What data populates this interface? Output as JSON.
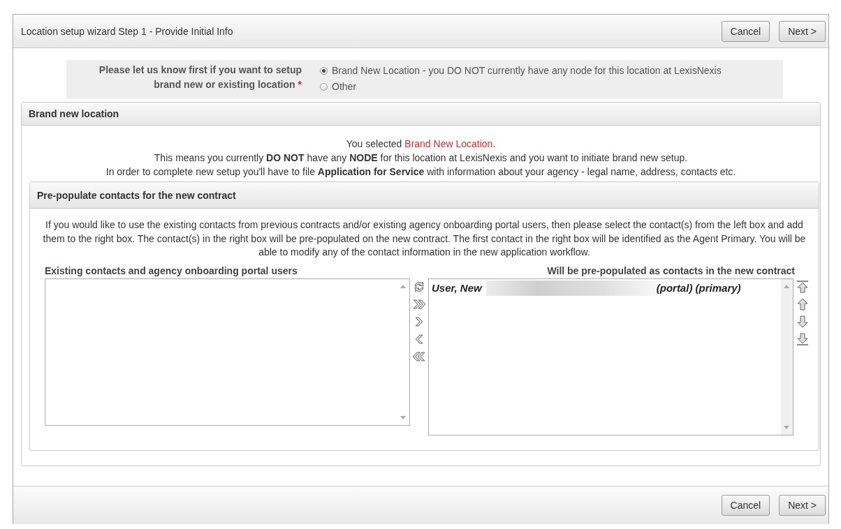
{
  "window": {
    "title": "Location setup wizard Step 1 - Provide Initial Info"
  },
  "header_buttons": [
    {
      "label": "Cancel"
    },
    {
      "label": "Next >"
    }
  ],
  "location_question": {
    "label": "Please let us know first if you want to setup brand new or existing location",
    "required_mark": "*",
    "options": [
      {
        "label": "Brand New Location - you DO NOT currently have any node for this location at LexisNexis",
        "selected": true
      },
      {
        "label": "Other",
        "selected": false
      }
    ]
  },
  "brand_new_panel": {
    "title": "Brand new location",
    "notice": {
      "prefix": "You selected ",
      "highlight": "Brand New Location",
      "suffix": "."
    },
    "lines": [
      "This means you currently **DO NOT** have any **NODE** for this location at LexisNexis and you want to initiate brand new setup.",
      "In order to complete new setup you'll have to file **Application for Service** with information about your agency - legal name, address, contacts etc."
    ]
  },
  "contacts_panel": {
    "title": "Pre-populate contacts for the new contract",
    "description": "If you would like to use the existing contacts from previous contracts and/or existing agency onboarding portal users, then please select the contact(s) from the left box and add them to the right box. The contact(s) in the right box will be pre-populated on the new contract. The first contact in the right box will be identified as the Agent Primary. You will be able to modify any of the contact information in the new application workflow.",
    "available": {
      "heading": "Existing contacts and agency onboarding portal users"
    },
    "transfer_buttons": [
      {
        "kind": "swap"
      },
      {
        "kind": "add_all"
      },
      {
        "kind": "add"
      },
      {
        "kind": "remove"
      },
      {
        "kind": "remove_all"
      }
    ],
    "selected_list": {
      "heading": "Will be pre-populated as contacts in the new contract",
      "items": [
        {
          "name": "User, New",
          "redacted": true,
          "tags": "(portal) (primary)"
        }
      ]
    },
    "order_buttons": [
      {
        "kind": "top"
      },
      {
        "kind": "up"
      },
      {
        "kind": "down"
      },
      {
        "kind": "bottom"
      }
    ]
  },
  "footer_buttons": [
    {
      "label": "Cancel"
    },
    {
      "label": "Next >"
    }
  ]
}
